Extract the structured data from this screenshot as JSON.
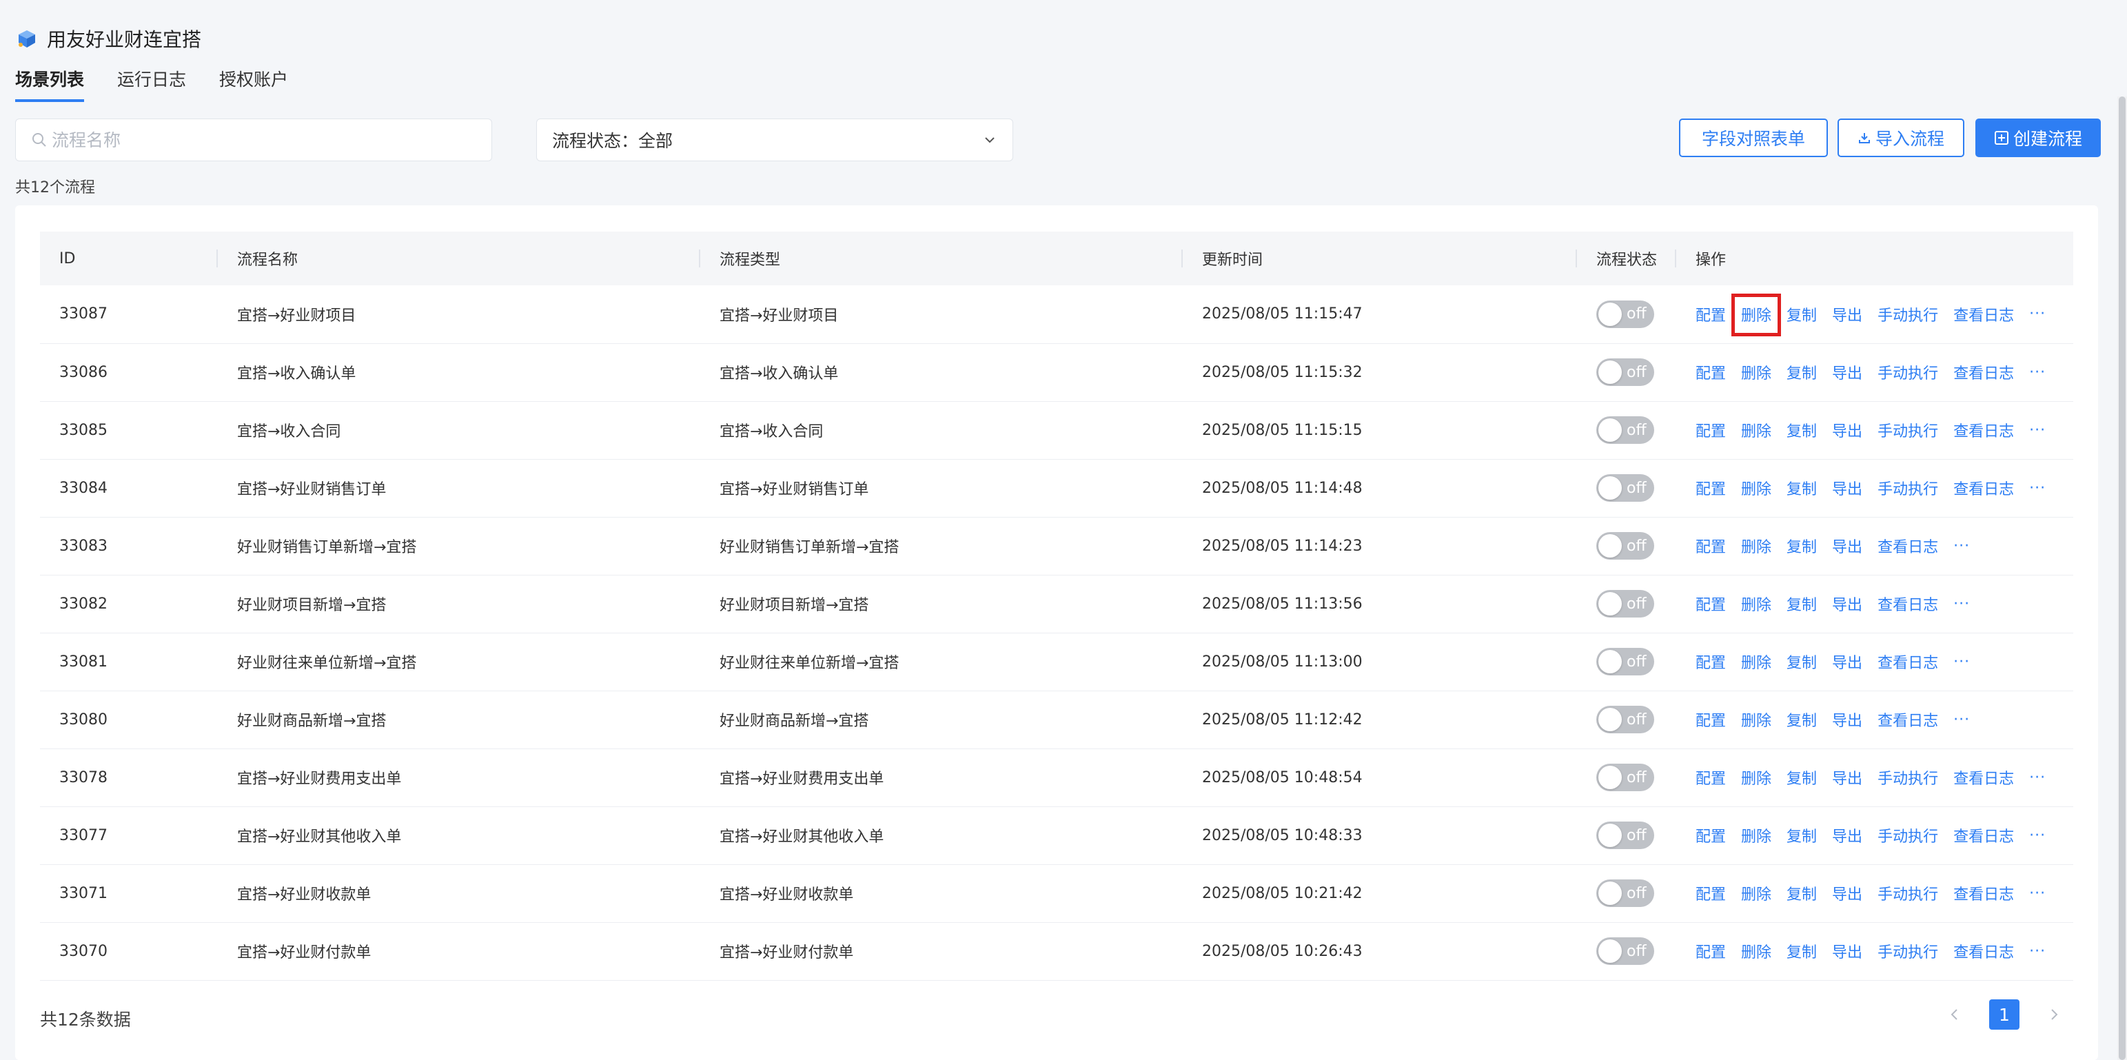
{
  "app": {
    "title": "用友好业财连宜搭"
  },
  "tabs": [
    {
      "label": "场景列表",
      "active": true
    },
    {
      "label": "运行日志",
      "active": false
    },
    {
      "label": "授权账户",
      "active": false
    }
  ],
  "search": {
    "placeholder": "流程名称",
    "value": ""
  },
  "status_filter": {
    "label": "流程状态：",
    "value": "全部"
  },
  "buttons": {
    "field_map": "字段对照表单",
    "import": "导入流程",
    "create": "创建流程"
  },
  "summary": {
    "count_text": "共12个流程",
    "total_text": "共12条数据"
  },
  "table": {
    "columns": [
      "ID",
      "流程名称",
      "流程类型",
      "更新时间",
      "流程状态",
      "操作"
    ],
    "rows": [
      {
        "id": "33087",
        "name": "宜搭→好业财项目",
        "type": "宜搭→好业财项目",
        "time": "2025/08/05 11:15:47",
        "status": "off",
        "actions": [
          "配置",
          "删除",
          "复制",
          "导出",
          "手动执行",
          "查看日志"
        ],
        "highlight_action": "删除"
      },
      {
        "id": "33086",
        "name": "宜搭→收入确认单",
        "type": "宜搭→收入确认单",
        "time": "2025/08/05 11:15:32",
        "status": "off",
        "actions": [
          "配置",
          "删除",
          "复制",
          "导出",
          "手动执行",
          "查看日志"
        ]
      },
      {
        "id": "33085",
        "name": "宜搭→收入合同",
        "type": "宜搭→收入合同",
        "time": "2025/08/05 11:15:15",
        "status": "off",
        "actions": [
          "配置",
          "删除",
          "复制",
          "导出",
          "手动执行",
          "查看日志"
        ]
      },
      {
        "id": "33084",
        "name": "宜搭→好业财销售订单",
        "type": "宜搭→好业财销售订单",
        "time": "2025/08/05 11:14:48",
        "status": "off",
        "actions": [
          "配置",
          "删除",
          "复制",
          "导出",
          "手动执行",
          "查看日志"
        ]
      },
      {
        "id": "33083",
        "name": "好业财销售订单新增→宜搭",
        "type": "好业财销售订单新增→宜搭",
        "time": "2025/08/05 11:14:23",
        "status": "off",
        "actions": [
          "配置",
          "删除",
          "复制",
          "导出",
          "查看日志"
        ]
      },
      {
        "id": "33082",
        "name": "好业财项目新增→宜搭",
        "type": "好业财项目新增→宜搭",
        "time": "2025/08/05 11:13:56",
        "status": "off",
        "actions": [
          "配置",
          "删除",
          "复制",
          "导出",
          "查看日志"
        ]
      },
      {
        "id": "33081",
        "name": "好业财往来单位新增→宜搭",
        "type": "好业财往来单位新增→宜搭",
        "time": "2025/08/05 11:13:00",
        "status": "off",
        "actions": [
          "配置",
          "删除",
          "复制",
          "导出",
          "查看日志"
        ]
      },
      {
        "id": "33080",
        "name": "好业财商品新增→宜搭",
        "type": "好业财商品新增→宜搭",
        "time": "2025/08/05 11:12:42",
        "status": "off",
        "actions": [
          "配置",
          "删除",
          "复制",
          "导出",
          "查看日志"
        ]
      },
      {
        "id": "33078",
        "name": "宜搭→好业财费用支出单",
        "type": "宜搭→好业财费用支出单",
        "time": "2025/08/05 10:48:54",
        "status": "off",
        "actions": [
          "配置",
          "删除",
          "复制",
          "导出",
          "手动执行",
          "查看日志"
        ]
      },
      {
        "id": "33077",
        "name": "宜搭→好业财其他收入单",
        "type": "宜搭→好业财其他收入单",
        "time": "2025/08/05 10:48:33",
        "status": "off",
        "actions": [
          "配置",
          "删除",
          "复制",
          "导出",
          "手动执行",
          "查看日志"
        ]
      },
      {
        "id": "33071",
        "name": "宜搭→好业财收款单",
        "type": "宜搭→好业财收款单",
        "time": "2025/08/05 10:21:42",
        "status": "off",
        "actions": [
          "配置",
          "删除",
          "复制",
          "导出",
          "手动执行",
          "查看日志"
        ]
      },
      {
        "id": "33070",
        "name": "宜搭→好业财付款单",
        "type": "宜搭→好业财付款单",
        "time": "2025/08/05 10:26:43",
        "status": "off",
        "actions": [
          "配置",
          "删除",
          "复制",
          "导出",
          "手动执行",
          "查看日志"
        ]
      }
    ],
    "more_label": "···"
  },
  "pagination": {
    "current": "1"
  },
  "icons": {
    "logo": "cube-logo-icon",
    "search": "search-icon",
    "dropdown": "chevron-down-icon",
    "import": "download-icon",
    "create": "plus-square-icon",
    "prev": "chevron-left-icon",
    "next": "chevron-right-icon"
  },
  "colors": {
    "accent": "#2e7ef3",
    "highlight": "#e02020",
    "toggle_off": "#bfc2c7"
  }
}
